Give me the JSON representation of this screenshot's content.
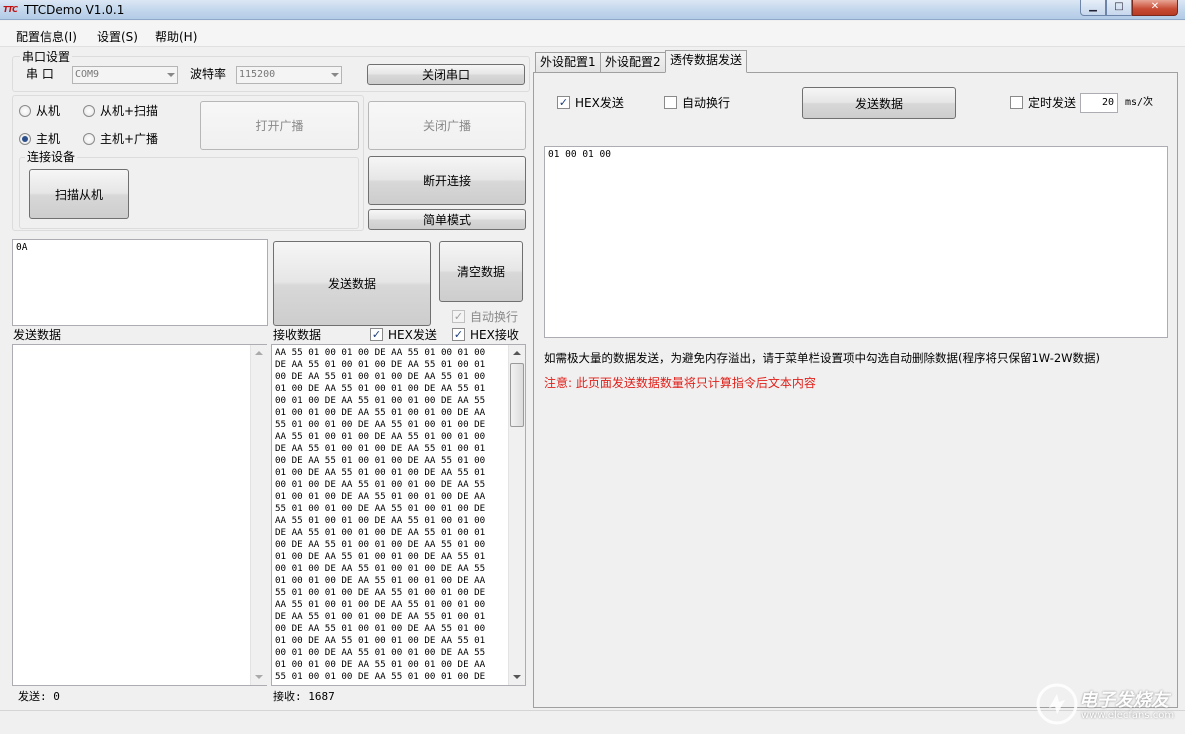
{
  "window": {
    "title": "TTCDemo V1.0.1",
    "logo_text": "TTC"
  },
  "menu": [
    "配置信息(I)",
    "设置(S)",
    "帮助(H)"
  ],
  "serial": {
    "group_label": "串口设置",
    "port_label": "串 口",
    "port_value": "COM9",
    "baud_label": "波特率",
    "baud_value": "115200",
    "close_port_label": "关闭串口"
  },
  "mode": {
    "slave": "从机",
    "slave_scan": "从机+扫描",
    "master": "主机",
    "master_broadcast": "主机+广播",
    "selected": "主机"
  },
  "buttons": {
    "open_broadcast": "打开广播",
    "close_broadcast": "关闭广播",
    "disconnect": "断开连接",
    "simple_mode": "简单模式",
    "scan_slave": "扫描从机",
    "send_data": "发送数据",
    "clear_data": "清空数据"
  },
  "connect": {
    "group_label": "连接设备"
  },
  "left": {
    "send_input_value": "0A",
    "send_data_label": "发送数据",
    "recv_data_label": "接收数据",
    "auto_newline_label": "自动换行",
    "hex_send_label": "HEX发送",
    "hex_recv_label": "HEX接收",
    "send_count_text": "发送: 0",
    "recv_count_text": "接收:  1687",
    "recv_log": "AA 55 01 00 01 00 DE AA 55 01 00 01 00\nDE AA 55 01 00 01 00 DE AA 55 01 00 01\n00 DE AA 55 01 00 01 00 DE AA 55 01 00\n01 00 DE AA 55 01 00 01 00 DE AA 55 01\n00 01 00 DE AA 55 01 00 01 00 DE AA 55\n01 00 01 00 DE AA 55 01 00 01 00 DE AA\n55 01 00 01 00 DE AA 55 01 00 01 00 DE\nAA 55 01 00 01 00 DE AA 55 01 00 01 00\nDE AA 55 01 00 01 00 DE AA 55 01 00 01\n00 DE AA 55 01 00 01 00 DE AA 55 01 00\n01 00 DE AA 55 01 00 01 00 DE AA 55 01\n00 01 00 DE AA 55 01 00 01 00 DE AA 55\n01 00 01 00 DE AA 55 01 00 01 00 DE AA\n55 01 00 01 00 DE AA 55 01 00 01 00 DE\nAA 55 01 00 01 00 DE AA 55 01 00 01 00\nDE AA 55 01 00 01 00 DE AA 55 01 00 01\n00 DE AA 55 01 00 01 00 DE AA 55 01 00\n01 00 DE AA 55 01 00 01 00 DE AA 55 01\n00 01 00 DE AA 55 01 00 01 00 DE AA 55\n01 00 01 00 DE AA 55 01 00 01 00 DE AA\n55 01 00 01 00 DE AA 55 01 00 01 00 DE\nAA 55 01 00 01 00 DE AA 55 01 00 01 00\nDE AA 55 01 00 01 00 DE AA 55 01 00 01\n00 DE AA 55 01 00 01 00 DE AA 55 01 00\n01 00 DE AA 55 01 00 01 00 DE AA 55 01\n00 01 00 DE AA 55 01 00 01 00 DE AA 55\n01 00 01 00 DE AA 55 01 00 01 00 DE AA\n55 01 00 01 00 DE AA 55 01 00 01 00 DE"
  },
  "tabs": [
    "外设配置1",
    "外设配置2",
    "透传数据发送"
  ],
  "active_tab": "透传数据发送",
  "right": {
    "hex_send_label": "HEX发送",
    "auto_newline_label": "自动换行",
    "send_button": "发送数据",
    "timed_send_label": "定时发送",
    "interval_value": "20",
    "interval_unit": "ms/次",
    "text_value": "01 00 01 00",
    "info_text": "如需极大量的数据发送，为避免内存溢出，请于菜单栏设置项中勾选自动删除数据(程序将只保留1W-2W数据)",
    "warning_text": "注意: 此页面发送数据数量将只计算指令后文本内容"
  },
  "watermark": {
    "cn": "电子发烧友",
    "url": "www.elecfans.com"
  },
  "colors": {
    "warning": "#e0201a",
    "title_bar": "#c2d6ec",
    "close_button": "#c74a33"
  }
}
